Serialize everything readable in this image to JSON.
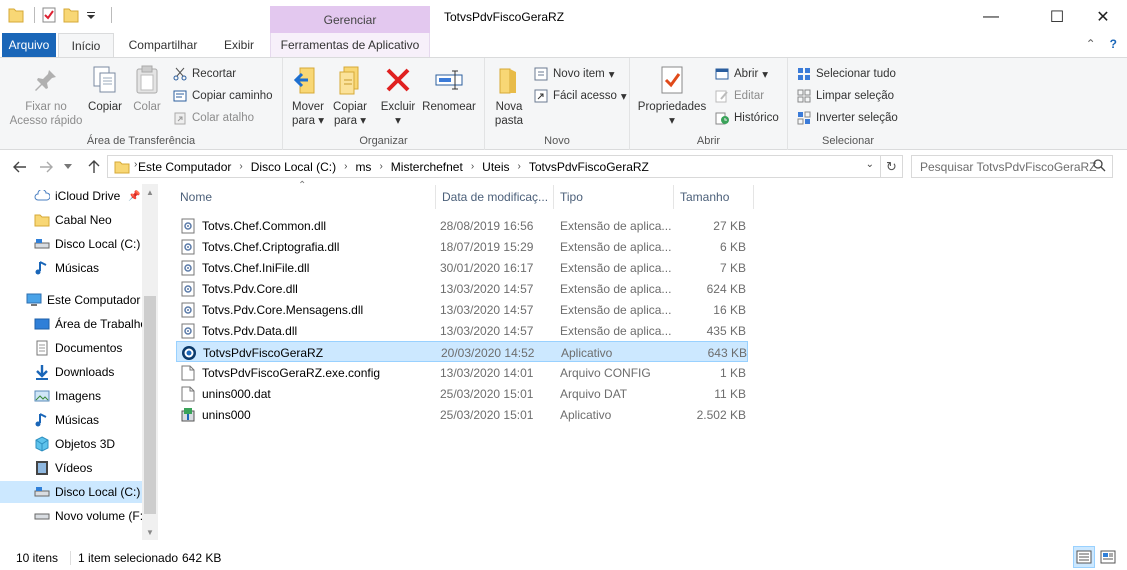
{
  "window": {
    "title": "TotvsPdvFiscoGeraRZ",
    "context_tab": "Gerenciar",
    "controls": [
      "—",
      "☐",
      "✕"
    ]
  },
  "ribbon_tabs": {
    "file": "Arquivo",
    "home": "Início",
    "share": "Compartilhar",
    "view": "Exibir",
    "app_tools": "Ferramentas de Aplicativo"
  },
  "ribbon": {
    "clipboard": {
      "label": "Área de Transferência",
      "pin_line1": "Fixar no",
      "pin_line2": "Acesso rápido",
      "copy": "Copiar",
      "paste": "Colar",
      "cut": "Recortar",
      "copy_path": "Copiar caminho",
      "paste_shortcut": "Colar atalho"
    },
    "organize": {
      "label": "Organizar",
      "move_line1": "Mover",
      "move_line2": "para",
      "copy_line1": "Copiar",
      "copy_line2": "para",
      "delete_line1": "Excluir",
      "rename": "Renomear"
    },
    "new": {
      "label": "Novo",
      "folder_line1": "Nova",
      "folder_line2": "pasta",
      "new_item": "Novo item",
      "easy_access": "Fácil acesso"
    },
    "open": {
      "label": "Abrir",
      "properties": "Propriedades",
      "open": "Abrir",
      "edit": "Editar",
      "history": "Histórico"
    },
    "select": {
      "label": "Selecionar",
      "select_all": "Selecionar tudo",
      "select_none": "Limpar seleção",
      "invert": "Inverter seleção"
    }
  },
  "address": {
    "crumbs": [
      "Este Computador",
      "Disco Local (C:)",
      "ms",
      "Misterchefnet",
      "Uteis",
      "TotvsPdvFiscoGeraRZ"
    ],
    "search_placeholder": "Pesquisar TotvsPdvFiscoGeraRZ"
  },
  "sidebar": {
    "items": [
      {
        "label": "iCloud Drive",
        "icon": "icloud-icon"
      },
      {
        "label": "Cabal Neo",
        "icon": "folder-icon"
      },
      {
        "label": "Disco Local (C:)",
        "icon": "drive-icon"
      },
      {
        "label": "Músicas",
        "icon": "music-icon"
      },
      {
        "label": "Este Computador",
        "icon": "computer-icon"
      },
      {
        "label": "Área de Trabalho",
        "icon": "desktop-icon"
      },
      {
        "label": "Documentos",
        "icon": "documents-icon"
      },
      {
        "label": "Downloads",
        "icon": "downloads-icon"
      },
      {
        "label": "Imagens",
        "icon": "pictures-icon"
      },
      {
        "label": "Músicas",
        "icon": "music-icon"
      },
      {
        "label": "Objetos 3D",
        "icon": "objects3d-icon"
      },
      {
        "label": "Vídeos",
        "icon": "videos-icon"
      },
      {
        "label": "Disco Local (C:)",
        "icon": "drive-icon"
      },
      {
        "label": "Novo volume (F:)",
        "icon": "drive-icon"
      }
    ]
  },
  "columns": {
    "name": "Nome",
    "date": "Data de modificaç...",
    "type": "Tipo",
    "size": "Tamanho"
  },
  "files": [
    {
      "name": "Totvs.Chef.Common.dll",
      "date": "28/08/2019 16:56",
      "type": "Extensão de aplica...",
      "size": "27 KB",
      "icon": "dll-icon"
    },
    {
      "name": "Totvs.Chef.Criptografia.dll",
      "date": "18/07/2019 15:29",
      "type": "Extensão de aplica...",
      "size": "6 KB",
      "icon": "dll-icon"
    },
    {
      "name": "Totvs.Chef.IniFile.dll",
      "date": "30/01/2020 16:17",
      "type": "Extensão de aplica...",
      "size": "7 KB",
      "icon": "dll-icon"
    },
    {
      "name": "Totvs.Pdv.Core.dll",
      "date": "13/03/2020 14:57",
      "type": "Extensão de aplica...",
      "size": "624 KB",
      "icon": "dll-icon"
    },
    {
      "name": "Totvs.Pdv.Core.Mensagens.dll",
      "date": "13/03/2020 14:57",
      "type": "Extensão de aplica...",
      "size": "16 KB",
      "icon": "dll-icon"
    },
    {
      "name": "Totvs.Pdv.Data.dll",
      "date": "13/03/2020 14:57",
      "type": "Extensão de aplica...",
      "size": "435 KB",
      "icon": "dll-icon"
    },
    {
      "name": "TotvsPdvFiscoGeraRZ",
      "date": "20/03/2020 14:52",
      "type": "Aplicativo",
      "size": "643 KB",
      "icon": "app-icon"
    },
    {
      "name": "TotvsPdvFiscoGeraRZ.exe.config",
      "date": "13/03/2020 14:01",
      "type": "Arquivo CONFIG",
      "size": "1 KB",
      "icon": "file-icon"
    },
    {
      "name": "unins000.dat",
      "date": "25/03/2020 15:01",
      "type": "Arquivo DAT",
      "size": "11 KB",
      "icon": "file-icon"
    },
    {
      "name": "unins000",
      "date": "25/03/2020 15:01",
      "type": "Aplicativo",
      "size": "2.502 KB",
      "icon": "installer-icon"
    }
  ],
  "status": {
    "count": "10 itens",
    "selected": "1 item selecionado",
    "selected_size": "642 KB"
  }
}
